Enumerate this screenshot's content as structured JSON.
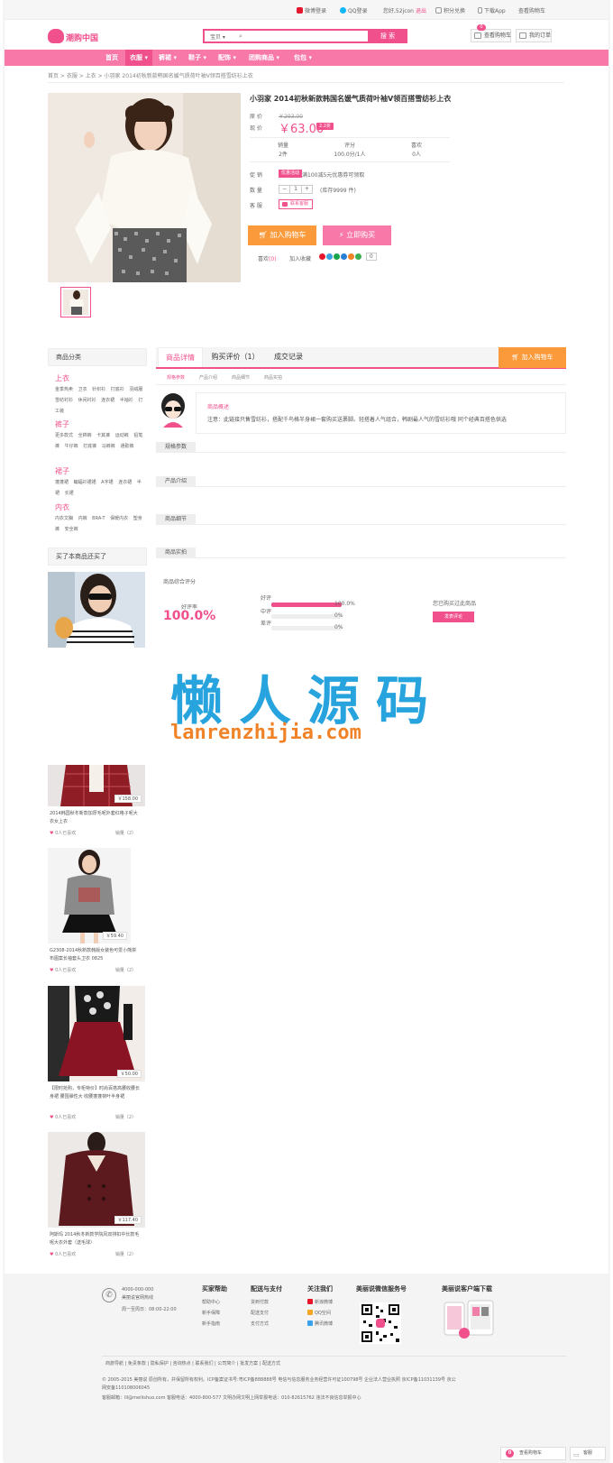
{
  "colors": {
    "accent": "#f0508c",
    "nav": "#f878a8",
    "orange": "#fa9a3a",
    "watermark_blue": "#27a3dd",
    "watermark_orange": "#f08327"
  },
  "topbar": {
    "weibo": "微博登录",
    "qq": "QQ登录",
    "greeting": "您好,52jcon",
    "logout": "退出",
    "points": "积分兑换",
    "app": "下载App",
    "cart": "查看购物车"
  },
  "header": {
    "logo_text": "潮购中国",
    "search_select": "宝贝 ▾",
    "search_placeholder": "",
    "search_button": "搜 索",
    "cart_button": "查看购物车",
    "cart_count": "0",
    "orders_button": "我的订单"
  },
  "nav": {
    "items": [
      "首页",
      "衣服 ▾",
      "裤裙 ▾",
      "鞋子 ▾",
      "配饰 ▾",
      "团购商品 ▾",
      "包包 ▾"
    ]
  },
  "breadcrumb": "首页 > 衣服 > 上衣 > 小羽家 2014初秋新款韩国名媛气质荷叶袖V领百搭雪纺衫上衣",
  "product": {
    "title": "小羽家 2014初秋新款韩国名媛气质荷叶袖V领百搭雪纺衫上衣",
    "orig_label": "原 价",
    "orig_price": "￥293.00",
    "now_label": "现 价",
    "price": "￥63.00",
    "discount": "2.2折",
    "stats": [
      {
        "label": "销量",
        "value": "2件"
      },
      {
        "label": "评分",
        "value": "100.0分/1人"
      },
      {
        "label": "喜欢",
        "value": "0人"
      }
    ],
    "promo_label": "促 销",
    "promo_tag": "优惠活动",
    "promo_text": "满100减5元优惠券可领取",
    "qty_label": "数 量",
    "qty_minus": "−",
    "qty_value": "1",
    "qty_plus": "+",
    "stock": "(库存9999 件)",
    "service_label": "客 服",
    "service_btn": "联系客服",
    "add_cart": "加入购物车",
    "buy_now": "立即购买",
    "like": "喜欢",
    "like_count": "(0)",
    "favorite": "加入收藏",
    "share_count": "0"
  },
  "sidebar": {
    "category_title": "商品分类",
    "groups": [
      {
        "name": "上衣",
        "items": "金季热卖 卫衣 针织衫 打底衫 羽绒服 雪纺衬衫 休闲衬衫 连衣裙 半袖衫 打工装"
      },
      {
        "name": "裤子",
        "items": "更多款式 全棉裤 卡其裤 运动裤 铅笔裤 牛仔裤 打底裤 马裤裤 通勤裤"
      },
      {
        "name": "裙子",
        "items": "蓬蓬裙 蝙蝠衫裙裙 A字裙 连衣裙 半裙 长裙"
      },
      {
        "name": "内衣",
        "items": "内衣文胸 内裤 BRA-T 保暖内衣 塑身裤 安全裤"
      }
    ],
    "also_bought_title": "买了本商品还买了"
  },
  "tabs": {
    "items": [
      "商品详情",
      "购买评价（1）",
      "成交记录"
    ],
    "cart_btn": "加入购物车",
    "sub": [
      "规格参数",
      "产品介绍",
      "商品细节",
      "商品实拍"
    ]
  },
  "summary": {
    "title": "商品概述",
    "text": "注意：此链接只售雪纺衫，搭配千鸟格半身裙一套购买送裹脚。轻搭着人气组合，韩剧最人气的雪纺衫哦 同个经典百搭色供选"
  },
  "sections": [
    "规格参数",
    "产品介绍",
    "商品细节",
    "商品实拍"
  ],
  "rating": {
    "title": "商品综合评分",
    "good_rate_label": "好评率",
    "good_rate": "100.0%",
    "rows": [
      {
        "label": "好评",
        "value": "100.0%",
        "fraction": 1.0
      },
      {
        "label": "中评",
        "value": "0%",
        "fraction": 0
      },
      {
        "label": "差评",
        "value": "0%",
        "fraction": 0
      }
    ],
    "bought_text": "您已购买过此商品",
    "review_btn": "发表评论"
  },
  "watermark": {
    "cn": "懒人源码",
    "en": "lanrenzhijia.com"
  },
  "products": [
    {
      "price": "￥158.00",
      "name": "2014韩国秋冬新款加厚毛呢外套红格子呢大衣女上衣",
      "likes": "0人已喜欢",
      "sales": "销量（2）"
    },
    {
      "price": "￥59.40",
      "name": "G2308-2014秋新款韩版女装色可爱小熊拼布图案长袖套头卫衣 0825",
      "likes": "0人已喜欢",
      "sales": "销量（2）"
    },
    {
      "price": "￥50.00",
      "name": "【限时抢购，专柜特价】时尚百搭高腰收腰长身裙 腰围弹性大 收腰蓬蓬荷叶半身裙",
      "likes": "0人已喜欢",
      "sales": "销量（2）"
    },
    {
      "price": "￥117.40",
      "name": "阿斯玛 2014秋冬新款学院风双排扣中长款毛呢大衣外套（送毛球）",
      "likes": "0人已喜欢",
      "sales": "销量（2）"
    }
  ],
  "footer": {
    "phone": "4000-000-000",
    "phone_sub": "美丽说官网热线",
    "hours": "周一至周日：08:00-22:00",
    "cols": [
      {
        "title": "买家帮助",
        "links": [
          "帮助中心",
          "新手保障",
          "新手指南"
        ]
      },
      {
        "title": "配送与支付",
        "links": [
          "货到付款",
          "配送支付",
          "支付方式"
        ]
      },
      {
        "title": "关注我们",
        "links": [
          "新浪微博",
          "QQ空间",
          "腾讯微博"
        ]
      }
    ],
    "wechat_title": "美丽说微信服务号",
    "app_title": "美丽说客户端下载",
    "links_row": "商旅导航 | 免责条款 | 隐私保护 | 咨询热点 | 联系我们 | 公司简介 | 批发方案 | 配送方式",
    "copyright1": "© 2005-2015 美丽说 原创所有，并保留所有权利。ICP备案证书号:粤ICP备888888号  电信与信息服务业务经营许可证100798号  企业法人营业执照  京ICP备11031139号  京公",
    "copyright2": "网安备110108006045",
    "copyright3": "客服邮箱：lll@meilishuo.com  客服电话：4000-800-577  文明办网文明上网举报电话：010-82615762  违法不良信息举报中心"
  },
  "float": {
    "cart": "查看购物车",
    "cart_count": "0",
    "msg": "客服"
  }
}
